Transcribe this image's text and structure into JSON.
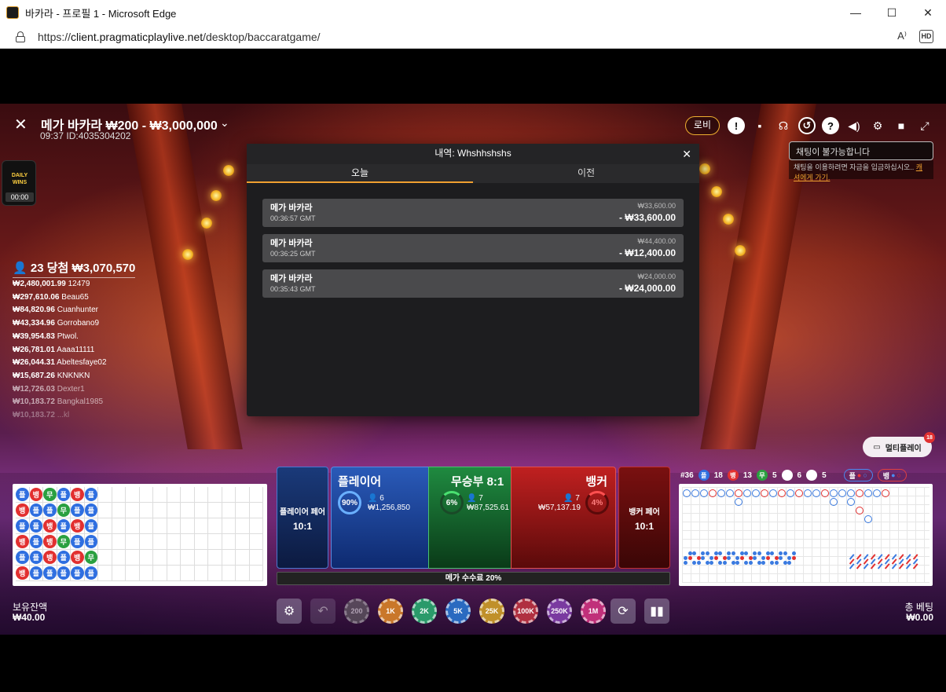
{
  "window": {
    "title": "바카라 - 프로필 1 - Microsoft Edge",
    "minimize": "—",
    "maximize": "☐",
    "close": "✕"
  },
  "address": {
    "scheme": "https://",
    "host": "client.pragmaticplaylive.net",
    "path": "/desktop/baccaratgame/",
    "read_aloud": "A⁾",
    "hd": "HD"
  },
  "header": {
    "close": "✕",
    "title": "메가 바카라 ₩200 - ₩3,000,000",
    "chevron": "⌄",
    "game_id": "09:37 ID:4035304202",
    "lobby": "로비",
    "chat_tooltip": "채팅이 불가능합니다",
    "chat_sub": "채팅을 이용하려면 자금을 입금하십시오..",
    "chat_link": "캐셔에게 가기."
  },
  "daily_wins": {
    "logo": "DAILY WINS",
    "timer": "00:00"
  },
  "winners": {
    "count": "23 당첨 ₩3,070,570",
    "rows": [
      {
        "amount": "₩2,480,001.99",
        "name": "12479"
      },
      {
        "amount": "₩297,610.06",
        "name": "Beau65"
      },
      {
        "amount": "₩84,820.96",
        "name": "Cuanhunter"
      },
      {
        "amount": "₩43,334.96",
        "name": "Gorrobano9"
      },
      {
        "amount": "₩39,954.83",
        "name": "Ptwol."
      },
      {
        "amount": "₩26,781.01",
        "name": "Aaaa11111"
      },
      {
        "amount": "₩26,044.31",
        "name": "Abeltesfaye02"
      },
      {
        "amount": "₩15,687.26",
        "name": "KNKNKN"
      },
      {
        "amount": "₩12,726.03",
        "name": "Dexter1"
      },
      {
        "amount": "₩10,183.72",
        "name": "Bangkal1985"
      },
      {
        "amount": "₩10,183.72",
        "name": "...kl"
      }
    ]
  },
  "history": {
    "title": "내역: Whshhshshs",
    "close": "✕",
    "tabs": [
      "오늘",
      "이전"
    ],
    "rows": [
      {
        "game": "메가 바카라",
        "time": "00:36:57 GMT",
        "bet": "₩33,600.00",
        "result": "- ₩33,600.00"
      },
      {
        "game": "메가 바카라",
        "time": "00:36:25 GMT",
        "bet": "₩44,400.00",
        "result": "- ₩12,400.00"
      },
      {
        "game": "메가 바카라",
        "time": "00:35:43 GMT",
        "bet": "₩24,000.00",
        "result": "- ₩24,000.00"
      }
    ]
  },
  "bead_road": {
    "columns": [
      [
        "p",
        "b",
        "p",
        "b",
        "p",
        "b"
      ],
      [
        "b",
        "p",
        "p",
        "p",
        "p",
        "p"
      ],
      [
        "t",
        "p",
        "b",
        "b",
        "b",
        "p"
      ],
      [
        "p",
        "t",
        "p",
        "t",
        "p",
        "p"
      ],
      [
        "b",
        "p",
        "b",
        "p",
        "b",
        "p"
      ],
      [
        "p",
        "p",
        "p",
        "p",
        "t",
        "p"
      ]
    ],
    "labels": {
      "p": "플",
      "b": "뱅",
      "t": "무"
    },
    "colors": {
      "p": "#2f6fe0",
      "b": "#e23030",
      "t": "#2aa040"
    }
  },
  "bets": {
    "player_pair": {
      "label": "플레이어 페어",
      "odds": "10:1"
    },
    "player": {
      "label": "플레이어",
      "pct": "90%",
      "bettors": "6",
      "total": "₩1,256,850"
    },
    "tie": {
      "label": "무승부 8:1",
      "pct": "6%",
      "bettors": "7",
      "total": "₩87,525.61"
    },
    "banker": {
      "label": "뱅커",
      "pct": "4%",
      "bettors": "7",
      "total": "₩57,137.19"
    },
    "banker_pair": {
      "label": "뱅커 페어",
      "odds": "10:1"
    },
    "commission": "메가 수수료 20%"
  },
  "road_stats": {
    "round": "#36",
    "player": {
      "label": "플",
      "count": "18"
    },
    "banker": {
      "label": "뱅",
      "count": "13"
    },
    "tie": {
      "label": "무",
      "count": "5"
    },
    "player_pair": "6",
    "banker_pair": "5",
    "ask_player": "플",
    "ask_banker": "뱅"
  },
  "multiplay": {
    "label": "멀티플레이",
    "badge": "18"
  },
  "bottom": {
    "balance_label": "보유잔액",
    "balance_value": "₩40.00",
    "total_label": "총 베팅",
    "total_value": "₩0.00",
    "chips": [
      "200",
      "1K",
      "2K",
      "5K",
      "25K",
      "100K",
      "250K",
      "1M"
    ],
    "chip_colors": [
      "#6a6a6a",
      "#c9772a",
      "#2a9a6a",
      "#2a6ac0",
      "#c0902a",
      "#b03040",
      "#7a3aa0",
      "#c0307a"
    ]
  }
}
